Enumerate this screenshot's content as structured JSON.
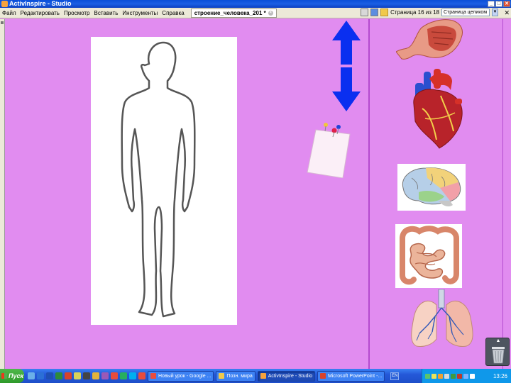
{
  "window": {
    "title": "ActivInspire - Studio",
    "minimize": "_",
    "maximize": "□",
    "close": "✕"
  },
  "menu": {
    "items": [
      "Файл",
      "Редактировать",
      "Просмотр",
      "Вставить",
      "Инструменты",
      "Справка"
    ]
  },
  "document_tab": {
    "label": "строение_человека_201 *",
    "close": "×"
  },
  "toolbar": {
    "page_info": "Страница 16 из 18",
    "zoom_value": "Страница целиком",
    "close_label": "✕"
  },
  "canvas": {
    "background": "#e18cf0",
    "items": [
      "human-body-outline",
      "arrow-up",
      "arrow-down",
      "pinned-note",
      "stomach",
      "heart",
      "brain",
      "intestines",
      "lungs",
      "trash"
    ]
  },
  "taskbar": {
    "start_label": "Пуск",
    "buttons": [
      {
        "label": "Новый урок - Google ...",
        "active": false
      },
      {
        "label": "Позн. мира",
        "active": false
      },
      {
        "label": "ActivInspire - Studio",
        "active": true
      },
      {
        "label": "Microsoft PowerPoint -...",
        "active": false
      }
    ],
    "language": "EN",
    "clock": "13:26"
  }
}
